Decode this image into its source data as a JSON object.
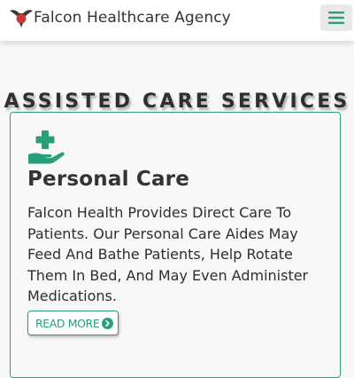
{
  "header": {
    "brand_name": "Falcon Healthcare Agency",
    "logo_icon": "falcon-logo-icon",
    "menu_icon": "hamburger-menu-icon"
  },
  "section": {
    "title": "ASSISTED CARE SERVICES"
  },
  "card": {
    "icon": "hand-holding-medical-icon",
    "title": "Personal Care",
    "description": "Falcon Health Provides Direct Care To Patients. Our Personal Care Aides May Feed And Bathe Patients, Help Rotate Them In Bed, And May Even Administer Medications.",
    "read_more_label": "READ MORE",
    "read_more_icon": "chevron-circle-right-icon"
  },
  "colors": {
    "accent": "#2a9d7a",
    "text": "#333333",
    "background": "#f7f7f7"
  }
}
